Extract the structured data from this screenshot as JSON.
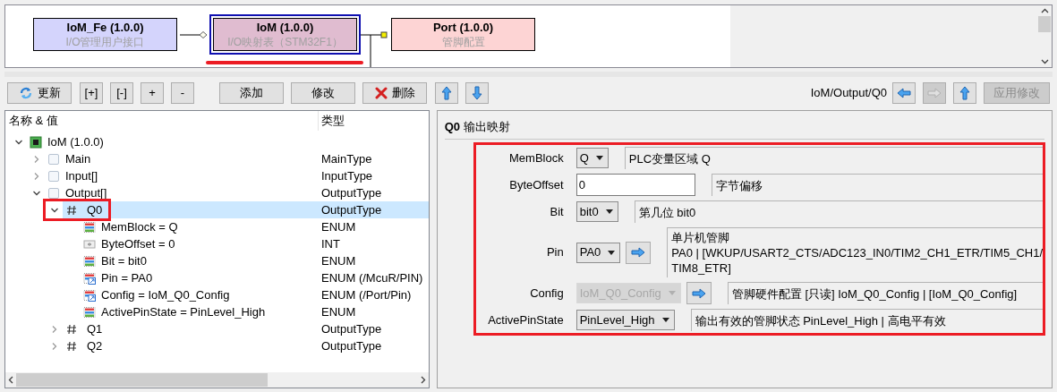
{
  "diagram": {
    "nodes": [
      {
        "title": "IoM_Fe (1.0.0)",
        "subtitle": "I/O管理用户接口",
        "color": "#d4d4fc",
        "selected": false,
        "highlighted": false
      },
      {
        "title": "IoM (1.0.0)",
        "subtitle": "I/O映射表（STM32F1）",
        "color": "#e0bcd0",
        "selected": true,
        "highlighted": true
      },
      {
        "title": "Port (1.0.0)",
        "subtitle": "管脚配置",
        "color": "#fdd4d4",
        "selected": false,
        "highlighted": false
      }
    ]
  },
  "toolbar": {
    "groups": [
      [
        {
          "label": "更新",
          "kind": "refresh"
        }
      ],
      [
        {
          "label": "[+]"
        },
        {
          "label": "[-]"
        },
        {
          "label": "+"
        },
        {
          "label": "-"
        }
      ],
      [
        {
          "label": "添加"
        },
        {
          "label": "修改"
        },
        {
          "label": "删除",
          "kind": "delete"
        }
      ],
      [
        {
          "kind": "up"
        },
        {
          "kind": "down"
        }
      ]
    ],
    "path": "IoM/Output/Q0",
    "nav": [
      {
        "kind": "left",
        "disabled": false
      },
      {
        "kind": "right",
        "disabled": true
      },
      {
        "kind": "up",
        "disabled": false
      },
      {
        "label": "应用修改",
        "disabled": true
      }
    ]
  },
  "tree": {
    "columns": [
      "名称 & 值",
      "类型"
    ],
    "items": [
      {
        "label": "IoM (1.0.0)",
        "kind": "chip",
        "expanded": true,
        "selected": false,
        "highlighted": false,
        "children": [
          {
            "label": "Main",
            "type": "MainType",
            "kind": "folder",
            "expanded": false,
            "selected": false,
            "highlighted": false
          },
          {
            "label": "Input[]",
            "type": "InputType",
            "kind": "folder",
            "expanded": false,
            "selected": false,
            "highlighted": false
          },
          {
            "label": "Output[]",
            "type": "OutputType",
            "kind": "folder",
            "expanded": true,
            "selected": false,
            "highlighted": false,
            "children": [
              {
                "label": "Q0",
                "type": "OutputType",
                "kind": "hash",
                "expanded": true,
                "selected": true,
                "highlighted": true,
                "children": [
                  {
                    "label": "MemBlock = Q",
                    "type": "ENUM",
                    "kind": "enum",
                    "selected": false,
                    "highlighted": false
                  },
                  {
                    "label": "ByteOffset = 0",
                    "type": "INT",
                    "kind": "int",
                    "selected": false,
                    "highlighted": false
                  },
                  {
                    "label": "Bit = bit0",
                    "type": "ENUM",
                    "kind": "enum",
                    "selected": false,
                    "highlighted": false
                  },
                  {
                    "label": "Pin = PA0",
                    "type": "ENUM (/McuR/PIN)",
                    "kind": "enum-link",
                    "selected": false,
                    "highlighted": false
                  },
                  {
                    "label": "Config = IoM_Q0_Config",
                    "type": "ENUM (/Port/Pin)",
                    "kind": "enum-link",
                    "selected": false,
                    "highlighted": false
                  },
                  {
                    "label": "ActivePinState = PinLevel_High",
                    "type": "ENUM",
                    "kind": "enum",
                    "selected": false,
                    "highlighted": false
                  }
                ]
              },
              {
                "label": "Q1",
                "type": "OutputType",
                "kind": "hash",
                "expanded": false,
                "selected": false,
                "highlighted": false
              },
              {
                "label": "Q2",
                "type": "OutputType",
                "kind": "hash",
                "expanded": false,
                "selected": false,
                "highlighted": false
              }
            ]
          }
        ]
      }
    ]
  },
  "form": {
    "title_id": "Q0",
    "title": "输出映射",
    "highlighted": true,
    "fields": [
      {
        "label": "MemBlock",
        "kind": "dropdown",
        "value": "Q",
        "link": false,
        "disabled": false,
        "description": [
          "PLC变量区域 Q"
        ]
      },
      {
        "label": "ByteOffset",
        "kind": "text",
        "value": "0",
        "link": false,
        "disabled": false,
        "description": [
          "字节偏移"
        ]
      },
      {
        "label": "Bit",
        "kind": "dropdown",
        "value": "bit0",
        "link": false,
        "disabled": false,
        "description": [
          "第几位 bit0"
        ]
      },
      {
        "label": "Pin",
        "kind": "dropdown",
        "value": "PA0",
        "link": true,
        "disabled": false,
        "description": [
          "单片机管脚",
          "PA0 | [WKUP/USART2_CTS/ADC123_IN0/TIM2_CH1_ETR/TIM5_CH1/",
          "TIM8_ETR]"
        ]
      },
      {
        "label": "Config",
        "kind": "dropdown",
        "value": "IoM_Q0_Config",
        "link": true,
        "disabled": true,
        "description": [
          "管脚硬件配置 [只读] IoM_Q0_Config | [IoM_Q0_Config]"
        ]
      },
      {
        "label": "ActivePinState",
        "kind": "dropdown",
        "value": "PinLevel_High",
        "link": false,
        "disabled": false,
        "description": [
          "输出有效的管脚状态 PinLevel_High | 高电平有效"
        ]
      }
    ]
  }
}
